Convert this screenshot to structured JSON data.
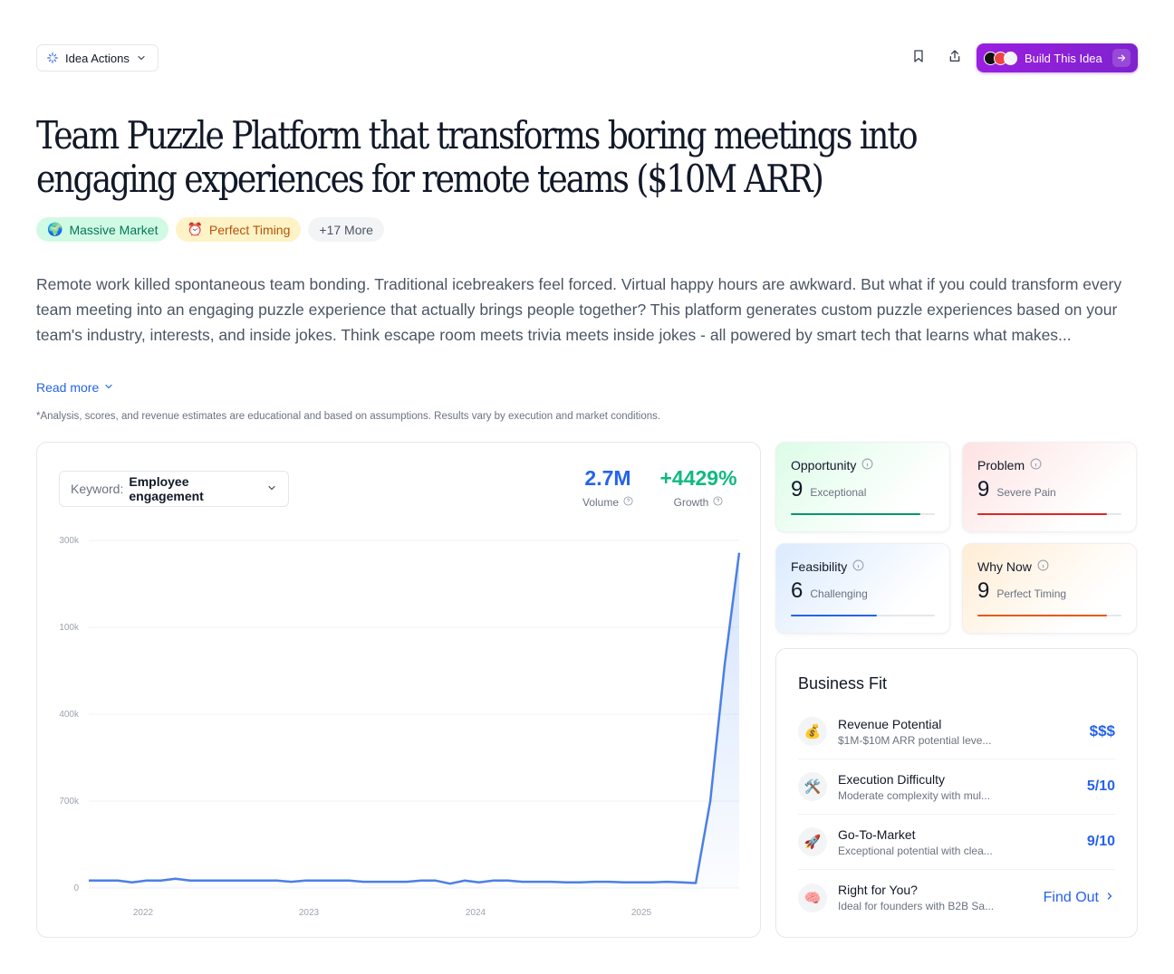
{
  "header": {
    "idea_actions_label": "Idea Actions",
    "build_label": "Build This Idea"
  },
  "title": "Team Puzzle Platform that transforms boring meetings into engaging experiences for remote teams ($10M ARR)",
  "tags": [
    {
      "emoji": "🌍",
      "label": "Massive Market"
    },
    {
      "emoji": "⏰",
      "label": "Perfect Timing"
    },
    {
      "emoji": "",
      "label": "+17 More"
    }
  ],
  "description": "Remote work killed spontaneous team bonding. Traditional icebreakers feel forced. Virtual happy hours are awkward. But what if you could transform every team meeting into an engaging puzzle experience that actually brings people together? This platform generates custom puzzle experiences based on your team's industry, interests, and inside jokes. Think escape room meets trivia meets inside jokes - all powered by smart tech that learns what makes...",
  "read_more": "Read more",
  "disclaimer": "*Analysis, scores, and revenue estimates are educational and based on assumptions. Results vary by execution and market conditions.",
  "trend": {
    "keyword_label": "Keyword:",
    "keyword_value": "Employee engagement",
    "volume_value": "2.7M",
    "volume_label": "Volume",
    "growth_value": "+4429%",
    "growth_label": "Growth"
  },
  "chart_data": {
    "type": "area",
    "y_tick_labels": [
      "300k",
      "100k",
      "400k",
      "700k",
      "0"
    ],
    "x_tick_labels": [
      "2022",
      "2023",
      "2024",
      "2025"
    ],
    "ylim": [
      0,
      2800000
    ],
    "series": [
      {
        "values": [
          60000,
          60000,
          60000,
          45000,
          60000,
          60000,
          75000,
          60000,
          60000,
          60000,
          60000,
          60000,
          60000,
          60000,
          50000,
          60000,
          60000,
          60000,
          60000,
          50000,
          50000,
          50000,
          50000,
          60000,
          60000,
          35000,
          60000,
          45000,
          60000,
          60000,
          50000,
          50000,
          50000,
          45000,
          45000,
          50000,
          50000,
          45000,
          45000,
          45000,
          50000,
          45000,
          40000,
          700000,
          1800000,
          2700000
        ]
      }
    ]
  },
  "scores": [
    {
      "label": "Opportunity",
      "value": "9",
      "desc": "Exceptional",
      "fill": 0.9,
      "color": "#059669",
      "bg": "linear-gradient(135deg, #dcfce7 0%, #ffffff 75%)"
    },
    {
      "label": "Problem",
      "value": "9",
      "desc": "Severe Pain",
      "fill": 0.9,
      "color": "#dc2626",
      "bg": "linear-gradient(135deg, #fee2e2 0%, #ffffff 75%)"
    },
    {
      "label": "Feasibility",
      "value": "6",
      "desc": "Challenging",
      "fill": 0.6,
      "color": "#2563eb",
      "bg": "linear-gradient(135deg, #dbeafe 0%, #ffffff 75%)"
    },
    {
      "label": "Why Now",
      "value": "9",
      "desc": "Perfect Timing",
      "fill": 0.9,
      "color": "#ea580c",
      "bg": "linear-gradient(135deg, #ffedd5 0%, #ffffff 75%)"
    }
  ],
  "business_fit": {
    "title": "Business Fit",
    "rows": [
      {
        "emoji": "💰",
        "label": "Revenue Potential",
        "sub": "$1M-$10M ARR potential leve...",
        "value": "$$$"
      },
      {
        "emoji": "🛠️",
        "label": "Execution Difficulty",
        "sub": "Moderate complexity with mul...",
        "value": "5/10"
      },
      {
        "emoji": "🚀",
        "label": "Go-To-Market",
        "sub": "Exceptional potential with clea...",
        "value": "9/10"
      },
      {
        "emoji": "🧠",
        "label": "Right for You?",
        "sub": "Ideal for founders with B2B Sa...",
        "value": "Find Out"
      }
    ]
  }
}
